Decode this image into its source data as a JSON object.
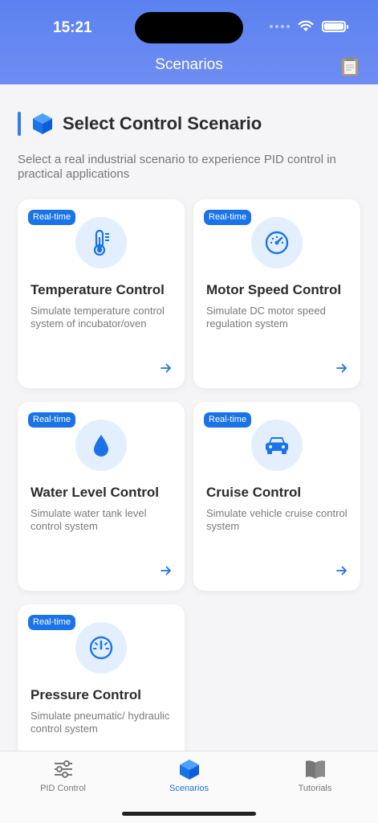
{
  "status": {
    "time": "15:21"
  },
  "nav": {
    "title": "Scenarios"
  },
  "section": {
    "title": "Select Control Scenario",
    "description": "Select a real industrial scenario to experience PID control in practical applications"
  },
  "scenarios": [
    {
      "badge": "Real-time",
      "title": "Temperature Control",
      "description": "Simulate temperature control system of incubator/oven",
      "icon": "thermometer-icon"
    },
    {
      "badge": "Real-time",
      "title": "Motor Speed Control",
      "description": "Simulate DC motor speed regulation system",
      "icon": "speedometer-icon"
    },
    {
      "badge": "Real-time",
      "title": "Water Level Control",
      "description": "Simulate water tank level control system",
      "icon": "water-drop-icon"
    },
    {
      "badge": "Real-time",
      "title": "Cruise Control",
      "description": "Simulate vehicle cruise control system",
      "icon": "car-icon"
    },
    {
      "badge": "Real-time",
      "title": "Pressure Control",
      "description": "Simulate pneumatic/ hydraulic control system",
      "icon": "pressure-gauge-icon"
    }
  ],
  "tabs": [
    {
      "label": "PID Control",
      "icon": "sliders-icon"
    },
    {
      "label": "Scenarios",
      "icon": "cube-icon",
      "active": true
    },
    {
      "label": "Tutorials",
      "icon": "book-icon"
    }
  ],
  "colors": {
    "accent": "#1a73e8",
    "header": "#5b82f0",
    "icon_bg": "#e3efff"
  }
}
